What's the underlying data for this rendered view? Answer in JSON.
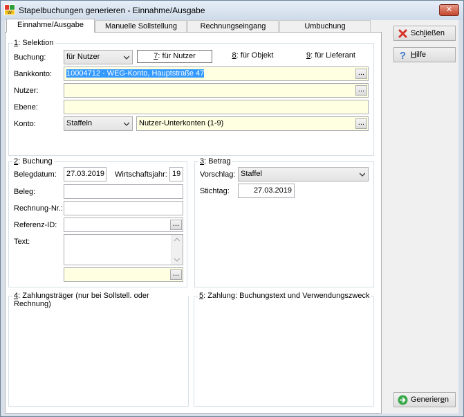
{
  "window": {
    "title": "Stapelbuchungen generieren - Einnahme/Ausgabe",
    "close_label": "✕"
  },
  "tabs": [
    {
      "label": "Einnahme/Ausgabe",
      "active": true
    },
    {
      "label": "Manuelle Sollstellung",
      "active": false
    },
    {
      "label": "Rechnungseingang",
      "active": false
    },
    {
      "label": "Umbuchung",
      "active": false
    }
  ],
  "selektion": {
    "group_num": "1",
    "group_rest": ": Selektion",
    "buchung_label": "Buchung:",
    "buchung_value": "für Nutzer",
    "mode_buttons": [
      {
        "key": "7",
        "rest": ": für Nutzer",
        "active": true
      },
      {
        "key": "8",
        "rest": ": für Objekt",
        "active": false
      },
      {
        "key": "9",
        "rest": ": für Lieferant",
        "active": false
      }
    ],
    "bankkonto_label": "Bankkonto:",
    "bankkonto_value": "10004712 - WEG-Konto,  Hauptstraße 47",
    "nutzer_label": "Nutzer:",
    "nutzer_value": "",
    "ebene_label": "Ebene:",
    "ebene_value": "",
    "konto_label": "Konto:",
    "konto_combo": "Staffeln",
    "konto_value": "Nutzer-Unterkonten (1-9)",
    "dots_label": "..."
  },
  "buchung": {
    "group_num": "2",
    "group_rest": ": Buchung",
    "belegdatum_label": "Belegdatum:",
    "belegdatum_value": "27.03.2019",
    "wirtschaftsjahr_label": "Wirtschaftsjahr:",
    "wirtschaftsjahr_value": "19",
    "beleg_label": "Beleg:",
    "rechnung_label": "Rechnung-Nr.:",
    "referenz_label": "Referenz-ID:",
    "text_label": "Text:"
  },
  "betrag": {
    "group_num": "3",
    "group_rest": ": Betrag",
    "vorschlag_label": "Vorschlag:",
    "vorschlag_value": "Staffel",
    "stichtag_label": "Stichtag:",
    "stichtag_value": "27.03.2019"
  },
  "zahlungstraeger": {
    "group_num": "4",
    "group_rest": ": Zahlungsträger (nur bei Sollstell. oder Rechnung)"
  },
  "zahlung": {
    "group_num": "5",
    "group_rest": ": Zahlung: Buchungstext und Verwendungszweck"
  },
  "side": {
    "schliessen_pre": "Sch",
    "schliessen_key": "l",
    "schliessen_post": "ießen",
    "hilfe_key": "H",
    "hilfe_post": "ilfe",
    "generieren_pre": "Generier",
    "generieren_key": "e",
    "generieren_post": "n"
  },
  "colors": {
    "required_field": "#ffffe1",
    "selection": "#3399ff"
  }
}
